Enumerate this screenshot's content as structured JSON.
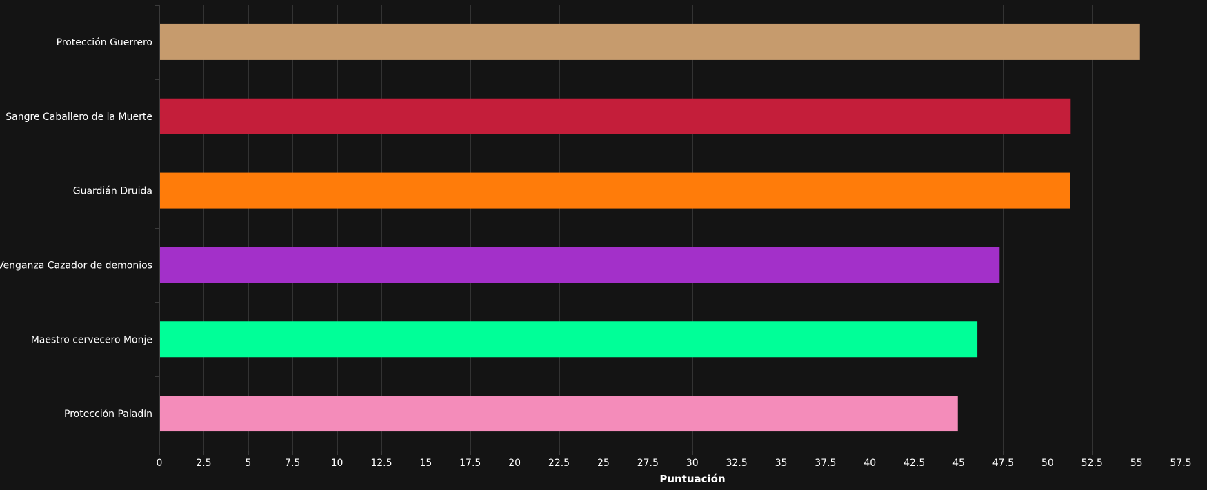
{
  "chart_data": {
    "type": "bar",
    "orientation": "horizontal",
    "categories": [
      "Protección Guerrero",
      "Sangre Caballero de la Muerte",
      "Guardián Druida",
      "Venganza Cazador de demonios",
      "Maestro cervecero Monje",
      "Protección Paladín"
    ],
    "values": [
      55.2,
      51.3,
      51.25,
      47.3,
      46.05,
      44.95
    ],
    "colors": [
      "#c69b6d",
      "#c41e3a",
      "#ff7c0a",
      "#a330c9",
      "#00ff98",
      "#f48cba"
    ],
    "xlabel": "Puntuación",
    "ylabel": "",
    "title": "",
    "xlim": [
      0,
      57.5
    ],
    "xticks": [
      "0",
      "2.5",
      "5",
      "7.5",
      "10",
      "12.5",
      "15",
      "17.5",
      "20",
      "22.5",
      "25",
      "27.5",
      "30",
      "32.5",
      "35",
      "37.5",
      "40",
      "42.5",
      "45",
      "47.5",
      "50",
      "52.5",
      "55",
      "57.5"
    ],
    "grid": "vertical",
    "legend": "none"
  },
  "theme": {
    "background": "#141414",
    "grid_color": "#333333",
    "axis_color": "#3a3a3a",
    "text_color": "#ffffff"
  }
}
